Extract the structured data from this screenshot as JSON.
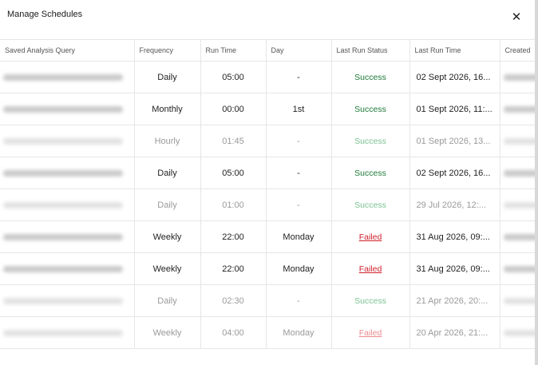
{
  "modal": {
    "title": "Manage Schedules",
    "close_icon": "close-icon",
    "close_glyph": "✕"
  },
  "table": {
    "columns": [
      "Saved Analysis Query",
      "Frequency",
      "Run Time",
      "Day",
      "Last Run Status",
      "Last Run Time",
      "Created"
    ],
    "rows": [
      {
        "frequency": "Daily",
        "run_time": "05:00",
        "day": "-",
        "status": "Success",
        "last_run": "02 Sept 2026, 16...",
        "disabled": false
      },
      {
        "frequency": "Monthly",
        "run_time": "00:00",
        "day": "1st",
        "status": "Success",
        "last_run": "01 Sept 2026, 11:...",
        "disabled": false
      },
      {
        "frequency": "Hourly",
        "run_time": "01:45",
        "day": "-",
        "status": "Success",
        "last_run": "01 Sept 2026, 13...",
        "disabled": true
      },
      {
        "frequency": "Daily",
        "run_time": "05:00",
        "day": "-",
        "status": "Success",
        "last_run": "02 Sept 2026, 16...",
        "disabled": false
      },
      {
        "frequency": "Daily",
        "run_time": "01:00",
        "day": "-",
        "status": "Success",
        "last_run": "29 Jul 2026, 12:...",
        "disabled": true
      },
      {
        "frequency": "Weekly",
        "run_time": "22:00",
        "day": "Monday",
        "status": "Failed",
        "last_run": "31 Aug 2026, 09:...",
        "disabled": false
      },
      {
        "frequency": "Weekly",
        "run_time": "22:00",
        "day": "Monday",
        "status": "Failed",
        "last_run": "31 Aug 2026, 09:...",
        "disabled": false
      },
      {
        "frequency": "Daily",
        "run_time": "02:30",
        "day": "-",
        "status": "Success",
        "last_run": "21 Apr 2026, 20:...",
        "disabled": true
      },
      {
        "frequency": "Weekly",
        "run_time": "04:00",
        "day": "Monday",
        "status": "Failed",
        "last_run": "20 Apr 2026, 21:...",
        "disabled": true
      }
    ]
  },
  "colors": {
    "success": "#1f7a3a",
    "failed": "#d0212b",
    "border": "#e6e6e6"
  }
}
